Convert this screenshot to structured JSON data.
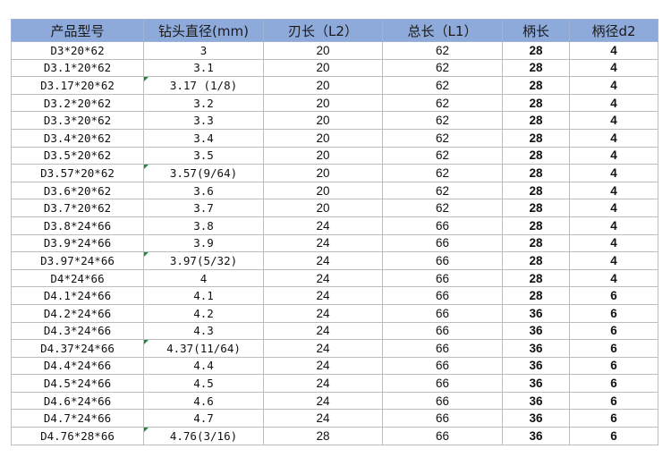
{
  "headers": [
    "产品型号",
    "钻头直径(mm)",
    "刃长（L2）",
    "总长（L1）",
    "柄长",
    "柄径d2"
  ],
  "rows": [
    {
      "model": "D3*20*62",
      "diameter": "3",
      "flute": "20",
      "total": "62",
      "shank_len": "28",
      "shank_dia": "4"
    },
    {
      "model": "D3.1*20*62",
      "diameter": "3.1",
      "flute": "20",
      "total": "62",
      "shank_len": "28",
      "shank_dia": "4"
    },
    {
      "model": "D3.17*20*62",
      "diameter": "3.17 (1/8)",
      "flute": "20",
      "total": "62",
      "shank_len": "28",
      "shank_dia": "4",
      "flag": true
    },
    {
      "model": "D3.2*20*62",
      "diameter": "3.2",
      "flute": "20",
      "total": "62",
      "shank_len": "28",
      "shank_dia": "4"
    },
    {
      "model": "D3.3*20*62",
      "diameter": "3.3",
      "flute": "20",
      "total": "62",
      "shank_len": "28",
      "shank_dia": "4"
    },
    {
      "model": "D3.4*20*62",
      "diameter": "3.4",
      "flute": "20",
      "total": "62",
      "shank_len": "28",
      "shank_dia": "4"
    },
    {
      "model": "D3.5*20*62",
      "diameter": "3.5",
      "flute": "20",
      "total": "62",
      "shank_len": "28",
      "shank_dia": "4"
    },
    {
      "model": "D3.57*20*62",
      "diameter": "3.57(9/64)",
      "flute": "20",
      "total": "62",
      "shank_len": "28",
      "shank_dia": "4",
      "flag": true
    },
    {
      "model": "D3.6*20*62",
      "diameter": "3.6",
      "flute": "20",
      "total": "62",
      "shank_len": "28",
      "shank_dia": "4"
    },
    {
      "model": "D3.7*20*62",
      "diameter": "3.7",
      "flute": "20",
      "total": "62",
      "shank_len": "28",
      "shank_dia": "4"
    },
    {
      "model": "D3.8*24*66",
      "diameter": "3.8",
      "flute": "24",
      "total": "66",
      "shank_len": "28",
      "shank_dia": "4"
    },
    {
      "model": "D3.9*24*66",
      "diameter": "3.9",
      "flute": "24",
      "total": "66",
      "shank_len": "28",
      "shank_dia": "4"
    },
    {
      "model": "D3.97*24*66",
      "diameter": "3.97(5/32)",
      "flute": "24",
      "total": "66",
      "shank_len": "28",
      "shank_dia": "4",
      "flag": true
    },
    {
      "model": "D4*24*66",
      "diameter": "4",
      "flute": "24",
      "total": "66",
      "shank_len": "28",
      "shank_dia": "4"
    },
    {
      "model": "D4.1*24*66",
      "diameter": "4.1",
      "flute": "24",
      "total": "66",
      "shank_len": "28",
      "shank_dia": "6"
    },
    {
      "model": "D4.2*24*66",
      "diameter": "4.2",
      "flute": "24",
      "total": "66",
      "shank_len": "36",
      "shank_dia": "6"
    },
    {
      "model": "D4.3*24*66",
      "diameter": "4.3",
      "flute": "24",
      "total": "66",
      "shank_len": "36",
      "shank_dia": "6"
    },
    {
      "model": "D4.37*24*66",
      "diameter": "4.37(11/64)",
      "flute": "24",
      "total": "66",
      "shank_len": "36",
      "shank_dia": "6",
      "flag": true
    },
    {
      "model": "D4.4*24*66",
      "diameter": "4.4",
      "flute": "24",
      "total": "66",
      "shank_len": "36",
      "shank_dia": "6"
    },
    {
      "model": "D4.5*24*66",
      "diameter": "4.5",
      "flute": "24",
      "total": "66",
      "shank_len": "36",
      "shank_dia": "6"
    },
    {
      "model": "D4.6*24*66",
      "diameter": "4.6",
      "flute": "24",
      "total": "66",
      "shank_len": "36",
      "shank_dia": "6"
    },
    {
      "model": "D4.7*24*66",
      "diameter": "4.7",
      "flute": "24",
      "total": "66",
      "shank_len": "36",
      "shank_dia": "6"
    },
    {
      "model": "D4.76*28*66",
      "diameter": "4.76(3/16)",
      "flute": "28",
      "total": "66",
      "shank_len": "36",
      "shank_dia": "6",
      "flag": true
    }
  ],
  "colors": {
    "header_bg": "#8eaadb",
    "grid": "#bdbdbd",
    "comment_flag": "#1f8a3a"
  }
}
